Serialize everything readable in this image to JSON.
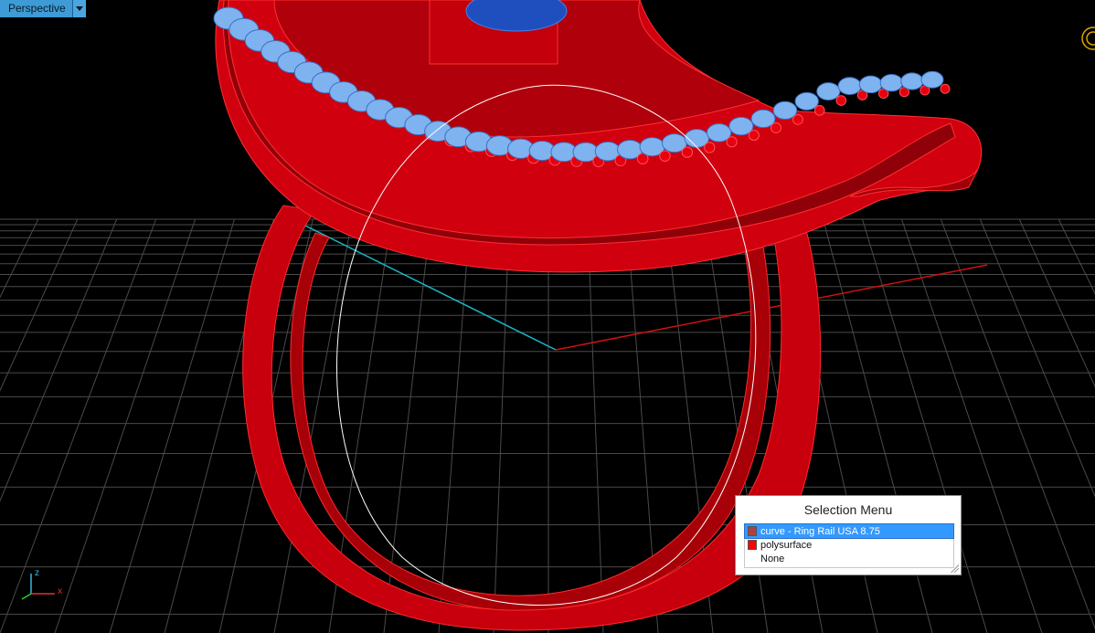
{
  "viewport": {
    "name": "Perspective"
  },
  "axes": {
    "z_label": "z",
    "x_label": "x"
  },
  "colors": {
    "object": "#e8000f",
    "gem": "#7fb3f0",
    "center_stone": "#1f4fbf",
    "highlight": "#ffffff",
    "grid": "#5a5a5a"
  },
  "selection_menu": {
    "title": "Selection Menu",
    "items": [
      {
        "label": "curve - Ring Rail USA 8.75",
        "swatch": "#b04040",
        "selected": true
      },
      {
        "label": "polysurface",
        "swatch": "#ff0000",
        "selected": false
      },
      {
        "label": "None",
        "swatch": "",
        "selected": false
      }
    ]
  }
}
